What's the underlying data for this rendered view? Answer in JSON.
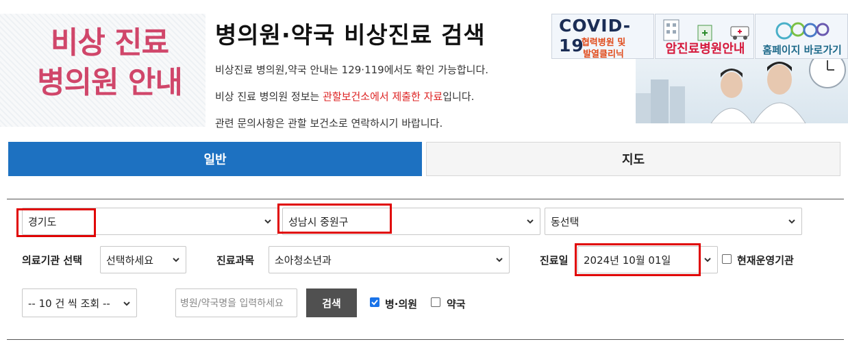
{
  "banner": {
    "title_line1": "비상 진료",
    "title_line2": "병의원 안내"
  },
  "page_title": "병의원·약국 비상진료 검색",
  "notices": {
    "line1": "비상진료 병의원,약국 안내는 129·119에서도 확인 가능합니다.",
    "line2_pre": "비상 진료 병의원 정보는 ",
    "line2_red": "관할보건소에서 제출한 자료",
    "line2_post": "입니다.",
    "line3": "관련 문의사항은 관할 보건소로 연락하시기 바랍니다."
  },
  "promos": {
    "covid_title": "COVID-19",
    "covid_sub1": "협력병원 및",
    "covid_sub2": "발열클리닉",
    "cancer": "암진료병원안내",
    "homepage": "홈페이지 바로가기"
  },
  "tabs": {
    "general": "일반",
    "map": "지도"
  },
  "filters": {
    "province": "경기도",
    "city": "성남시 중원구",
    "dong": "동선택",
    "institution_label": "의료기관 선택",
    "institution": "선택하세요",
    "department_label": "진료과목",
    "department": "소아청소년과",
    "date_label": "진료일",
    "date": "2024년 10월 01일",
    "operating_label": "현재운영기관",
    "page_size": "-- 10 건 씩 조회 --",
    "search_placeholder": "병원/약국명을 입력하세요",
    "search_button": "검색",
    "hospital_label": "병·의원",
    "pharmacy_label": "약국"
  },
  "colors": {
    "tab_active": "#1d71c1",
    "highlight": "#e00000",
    "banner_red": "#d0466a"
  }
}
